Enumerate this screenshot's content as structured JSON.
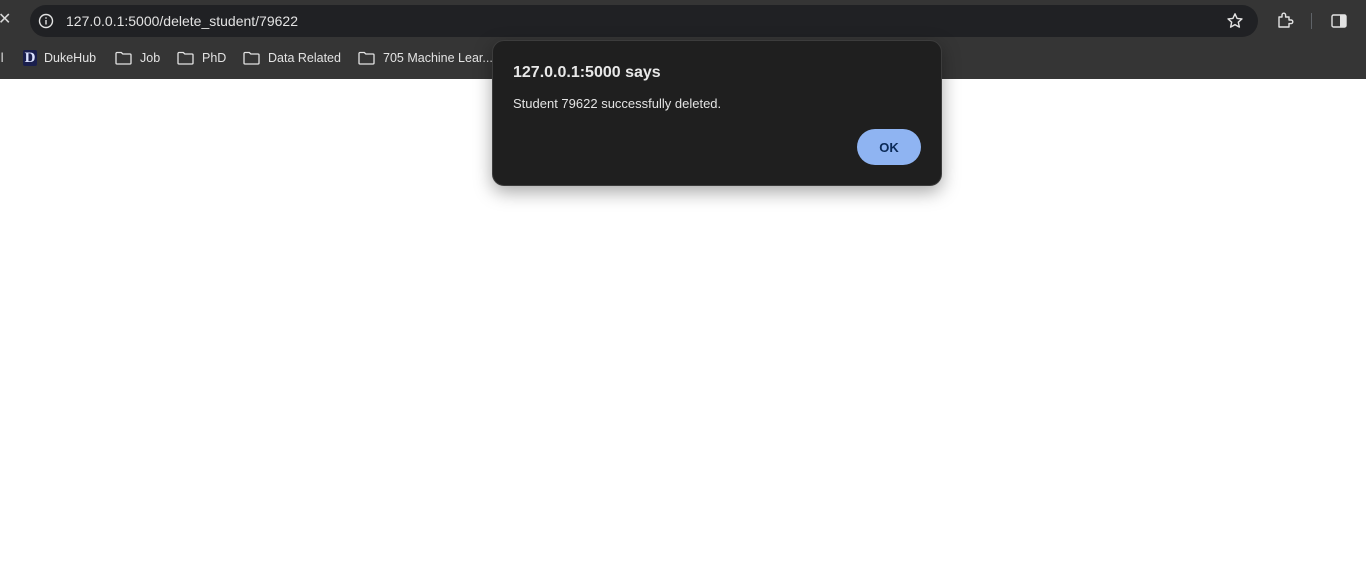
{
  "browser": {
    "url": "127.0.0.1:5000/delete_student/79622",
    "bookmarks": [
      {
        "label": "il",
        "icon": "partial-item"
      },
      {
        "label": "DukeHub",
        "icon": "duke-icon"
      },
      {
        "label": "Job",
        "icon": "folder-icon"
      },
      {
        "label": "PhD",
        "icon": "folder-icon"
      },
      {
        "label": "Data Related",
        "icon": "folder-icon"
      },
      {
        "label": "705 Machine Lear...",
        "icon": "folder-icon"
      }
    ],
    "duke_icon_letter": "D"
  },
  "dialog": {
    "title": "127.0.0.1:5000 says",
    "message": "Student 79622 successfully deleted.",
    "ok_label": "OK"
  },
  "colors": {
    "chrome_bg": "#353535",
    "omnibox_bg": "#202124",
    "dialog_bg": "#1f1f1f",
    "ok_button": "#8fb4f2"
  }
}
